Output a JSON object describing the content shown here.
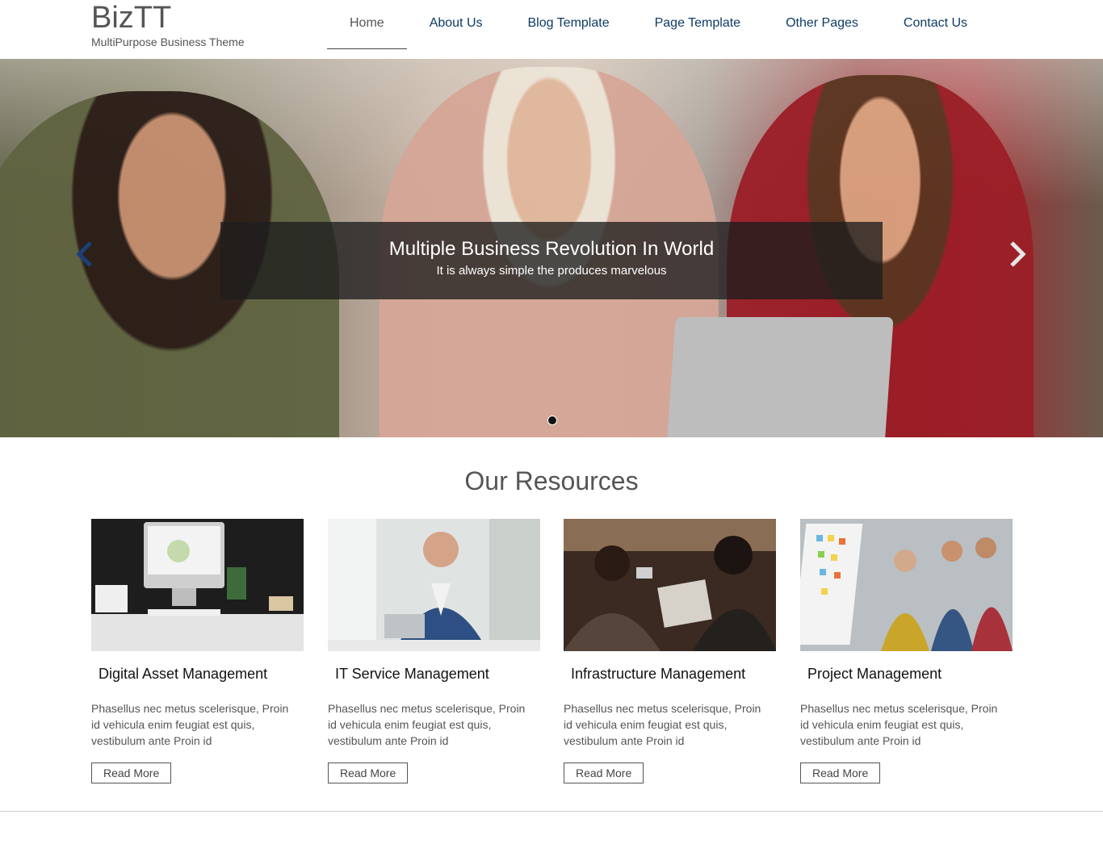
{
  "site": {
    "title": "BizTT",
    "tagline": "MultiPurpose Business Theme"
  },
  "nav": [
    {
      "label": "Home",
      "active": true
    },
    {
      "label": "About Us"
    },
    {
      "label": "Blog Template"
    },
    {
      "label": "Page Template"
    },
    {
      "label": "Other Pages"
    },
    {
      "label": "Contact Us"
    }
  ],
  "hero": {
    "title": "Multiple Business Revolution In World",
    "text": "It is always simple the produces marvelous",
    "prev_icon": "chevron-left-icon",
    "next_icon": "chevron-right-icon"
  },
  "resources": {
    "heading": "Our Resources",
    "items": [
      {
        "title": "Digital Asset Management",
        "text": "Phasellus nec metus scelerisque, Proin id vehicula enim feugiat est quis, vestibulum ante Proin id",
        "button": "Read More"
      },
      {
        "title": "IT Service Management",
        "text": "Phasellus nec metus scelerisque, Proin id vehicula enim feugiat est quis, vestibulum ante Proin id",
        "button": "Read More"
      },
      {
        "title": "Infrastructure Management",
        "text": "Phasellus nec metus scelerisque, Proin id vehicula enim feugiat est quis, vestibulum ante Proin id",
        "button": "Read More"
      },
      {
        "title": "Project Management",
        "text": "Phasellus nec metus scelerisque, Proin id vehicula enim feugiat est quis, vestibulum ante Proin id",
        "button": "Read More"
      }
    ]
  }
}
